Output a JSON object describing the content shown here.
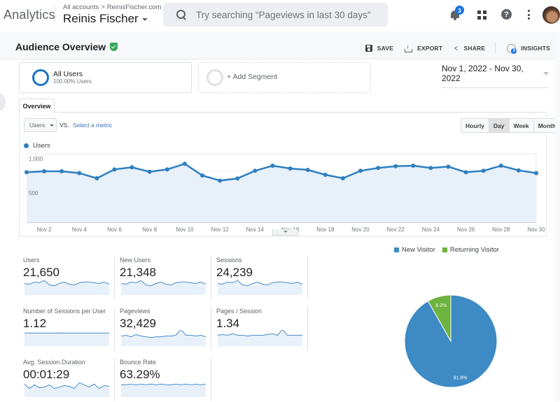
{
  "topbar": {
    "brand": "Analytics",
    "breadcrumb": {
      "root": "All accounts",
      "separator": ">",
      "property": "ReinisFischer.com"
    },
    "account_name": "Reinis Fischer",
    "search_placeholder": "Try searching “Pageviews in last 30 days”",
    "notifications_count": "3",
    "help_glyph": "?",
    "icons": [
      "search-icon",
      "bell-icon",
      "apps-grid-icon",
      "help-icon",
      "more-vert-icon",
      "avatar"
    ]
  },
  "header": {
    "title": "Audience Overview",
    "verified_icon": "shield-check-icon",
    "actions": {
      "save": "SAVE",
      "export": "EXPORT",
      "share": "SHARE",
      "insights": "INSIGHTS",
      "insights_badge": "3"
    }
  },
  "segments": {
    "active": {
      "name": "All Users",
      "sub": "100.00% Users"
    },
    "add_label": "+ Add Segment"
  },
  "date_range": "Nov 1, 2022 - Nov 30, 2022",
  "tabs": {
    "overview": "Overview"
  },
  "chart_controls": {
    "metric": "Users",
    "vs": "VS.",
    "select_metric": "Select a metric",
    "granularity": [
      "Hourly",
      "Day",
      "Week",
      "Month"
    ],
    "active_granularity": "Day"
  },
  "chart_data": {
    "type": "area",
    "series": [
      {
        "name": "Users",
        "color": "#2d7fc1",
        "values": [
          731,
          745,
          745,
          718,
          643,
          772,
          803,
          738,
          772,
          854,
          684,
          609,
          640,
          752,
          827,
          786,
          765,
          694,
          643,
          752,
          793,
          819,
          827,
          793,
          813,
          731,
          752,
          827,
          758,
          718
        ]
      }
    ],
    "x": [
      "Nov 1",
      "Nov 2",
      "Nov 3",
      "Nov 4",
      "Nov 5",
      "Nov 6",
      "Nov 7",
      "Nov 8",
      "Nov 9",
      "Nov 10",
      "Nov 11",
      "Nov 12",
      "Nov 13",
      "Nov 14",
      "Nov 15",
      "Nov 16",
      "Nov 17",
      "Nov 18",
      "Nov 19",
      "Nov 20",
      "Nov 21",
      "Nov 22",
      "Nov 23",
      "Nov 24",
      "Nov 25",
      "Nov 26",
      "Nov 27",
      "Nov 28",
      "Nov 29",
      "Nov 30"
    ],
    "x_tick_labels": [
      "Nov 2",
      "Nov 4",
      "Nov 6",
      "Nov 8",
      "Nov 10",
      "Nov 12",
      "Nov 14",
      "Nov 16",
      "Nov 18",
      "Nov 20",
      "Nov 22",
      "Nov 24",
      "Nov 26",
      "Nov 28",
      "Nov 30"
    ],
    "y_tick_labels": [
      "1,000",
      "500"
    ],
    "y_ticks": [
      1000,
      500
    ],
    "ylim": [
      0,
      1000
    ],
    "legend": "top-left",
    "grid": true
  },
  "metrics": [
    {
      "label": "Users",
      "value": "21,650",
      "spark": [
        0.5,
        0.45,
        0.6,
        0.55,
        0.7,
        0.4,
        0.35,
        0.5,
        0.6,
        0.45,
        0.4,
        0.55,
        0.6,
        0.6,
        0.55,
        0.5,
        0.6,
        0.45
      ]
    },
    {
      "label": "New Users",
      "value": "21,348",
      "spark": [
        0.5,
        0.45,
        0.6,
        0.55,
        0.7,
        0.4,
        0.35,
        0.5,
        0.6,
        0.45,
        0.4,
        0.55,
        0.6,
        0.6,
        0.55,
        0.5,
        0.6,
        0.45
      ]
    },
    {
      "label": "Sessions",
      "value": "24,239",
      "spark": [
        0.5,
        0.45,
        0.6,
        0.55,
        0.7,
        0.4,
        0.35,
        0.5,
        0.6,
        0.45,
        0.4,
        0.55,
        0.6,
        0.6,
        0.55,
        0.5,
        0.6,
        0.45
      ]
    },
    {
      "label": "Number of Sessions per User",
      "value": "1.12",
      "spark": [
        0.6,
        0.6,
        0.6,
        0.6,
        0.6,
        0.6,
        0.6,
        0.61,
        0.6,
        0.6,
        0.6,
        0.6,
        0.6,
        0.6,
        0.6,
        0.6,
        0.6,
        0.6
      ]
    },
    {
      "label": "Pageviews",
      "value": "32,429",
      "spark": [
        0.4,
        0.45,
        0.35,
        0.5,
        0.4,
        0.35,
        0.3,
        0.35,
        0.35,
        0.4,
        0.4,
        0.45,
        0.85,
        0.45,
        0.45,
        0.4,
        0.45,
        0.35
      ]
    },
    {
      "label": "Pages / Session",
      "value": "1.34",
      "spark": [
        0.45,
        0.5,
        0.45,
        0.55,
        0.45,
        0.45,
        0.4,
        0.45,
        0.45,
        0.45,
        0.5,
        0.55,
        0.45,
        0.85,
        0.45,
        0.45,
        0.45,
        0.45
      ]
    },
    {
      "label": "Avg. Session Duration",
      "value": "00:01:29",
      "spark": [
        0.6,
        0.3,
        0.55,
        0.35,
        0.4,
        0.55,
        0.3,
        0.4,
        0.5,
        0.45,
        0.3,
        0.7,
        0.55,
        0.4,
        0.6,
        0.3,
        0.5,
        0.45
      ]
    },
    {
      "label": "Bounce Rate",
      "value": "63.29%",
      "spark": [
        0.55,
        0.55,
        0.6,
        0.55,
        0.6,
        0.55,
        0.6,
        0.55,
        0.6,
        0.55,
        0.55,
        0.6,
        0.55,
        0.6,
        0.55,
        0.6,
        0.55,
        0.6
      ]
    }
  ],
  "pie": {
    "type": "pie",
    "slices": [
      {
        "label": "New Visitor",
        "value": 91.8,
        "display": "91.8%",
        "color": "#3d8ac4"
      },
      {
        "label": "Returning Visitor",
        "value": 8.2,
        "display": "8.2%",
        "color": "#6db33f"
      }
    ]
  }
}
